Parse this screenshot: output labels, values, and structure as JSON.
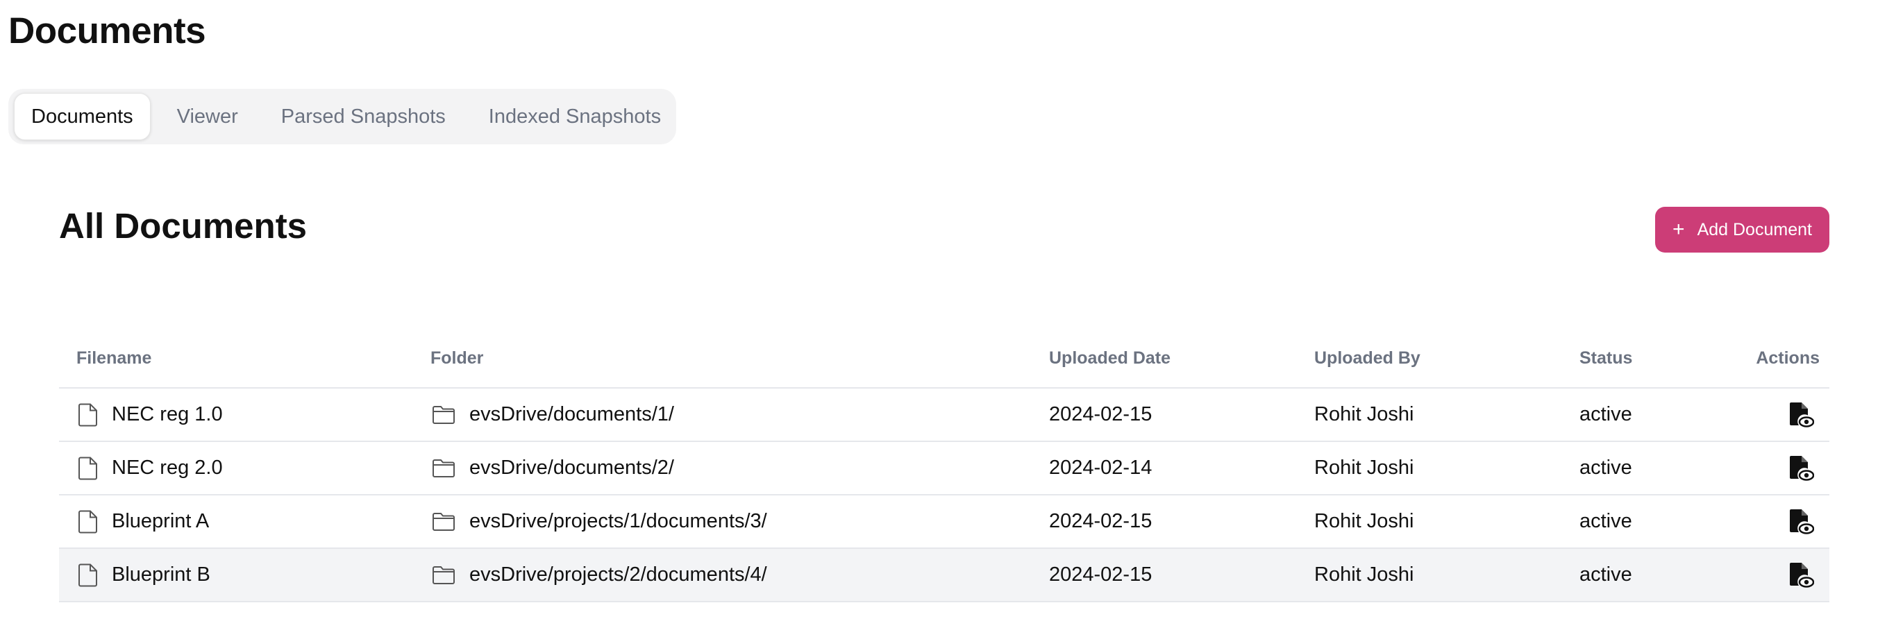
{
  "page": {
    "title": "Documents"
  },
  "tabs": [
    {
      "label": "Documents",
      "active": true
    },
    {
      "label": "Viewer",
      "active": false
    },
    {
      "label": "Parsed Snapshots",
      "active": false
    },
    {
      "label": "Indexed Snapshots",
      "active": false
    }
  ],
  "section": {
    "title": "All Documents",
    "add_button_label": "Add Document",
    "add_button_icon": "plus-icon",
    "accent_color": "#cc3d77"
  },
  "table": {
    "columns": [
      "Filename",
      "Folder",
      "Uploaded Date",
      "Uploaded By",
      "Status",
      "Actions"
    ],
    "rows": [
      {
        "filename": "NEC reg 1.0",
        "folder": "evsDrive/documents/1/",
        "uploaded_date": "2024-02-15",
        "uploaded_by": "Rohit Joshi",
        "status": "active",
        "action_icon": "file-view-icon"
      },
      {
        "filename": "NEC reg 2.0",
        "folder": "evsDrive/documents/2/",
        "uploaded_date": "2024-02-14",
        "uploaded_by": "Rohit Joshi",
        "status": "active",
        "action_icon": "file-view-icon"
      },
      {
        "filename": "Blueprint A",
        "folder": "evsDrive/projects/1/documents/3/",
        "uploaded_date": "2024-02-15",
        "uploaded_by": "Rohit Joshi",
        "status": "active",
        "action_icon": "file-view-icon"
      },
      {
        "filename": "Blueprint B",
        "folder": "evsDrive/projects/2/documents/4/",
        "uploaded_date": "2024-02-15",
        "uploaded_by": "Rohit Joshi",
        "status": "active",
        "action_icon": "file-view-icon"
      }
    ]
  }
}
